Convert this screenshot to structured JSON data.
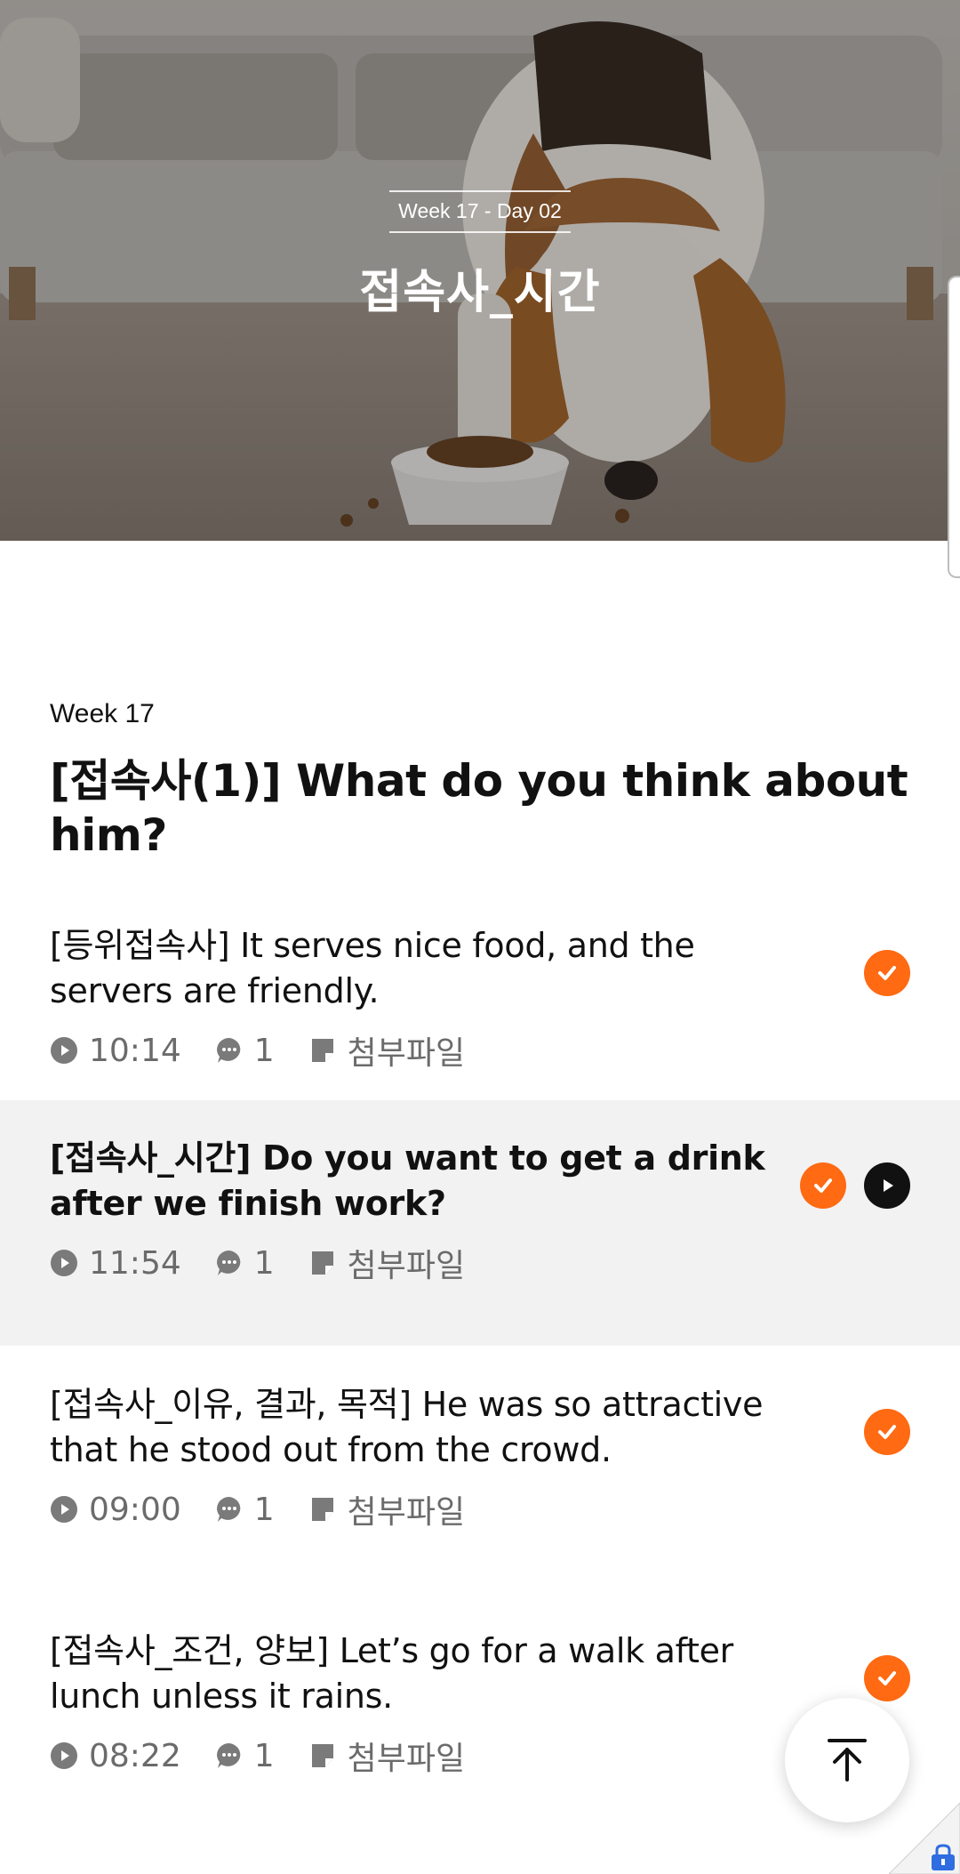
{
  "hero": {
    "tag": "Week 17 - Day 02",
    "title": "접속사_시간"
  },
  "section": {
    "week": "Week 17",
    "title": "[접속사(1)] What do you think about him?"
  },
  "lessons": [
    {
      "title": "[등위접속사] It serves nice food, and the servers are friendly.",
      "duration": "10:14",
      "comments": "1",
      "attachment": "첨부파일",
      "completed": true,
      "active": false
    },
    {
      "title": "[접속사_시간] Do you want to get a drink after we finish work?",
      "duration": "11:54",
      "comments": "1",
      "attachment": "첨부파일",
      "completed": true,
      "active": true
    },
    {
      "title": "[접속사_이유, 결과, 목적] He was so attractive that he stood out from the crowd.",
      "duration": "09:00",
      "comments": "1",
      "attachment": "첨부파일",
      "completed": true,
      "active": false
    },
    {
      "title": "[접속사_조건, 양보] Let’s go for a walk after lunch unless it rains.",
      "duration": "08:22",
      "comments": "1",
      "attachment": "첨부파일",
      "completed": true,
      "active": false
    }
  ],
  "colors": {
    "accent": "#ff6a13",
    "active_row_bg": "#f2f2f2",
    "meta_text": "#6b6b6b"
  },
  "icons": {
    "duration": "play-circle-icon",
    "comments": "comment-bubble-icon",
    "attachment": "note-icon",
    "completed": "check-circle-icon",
    "now_playing": "play-icon",
    "scroll_top": "arrow-up-to-top-icon"
  }
}
